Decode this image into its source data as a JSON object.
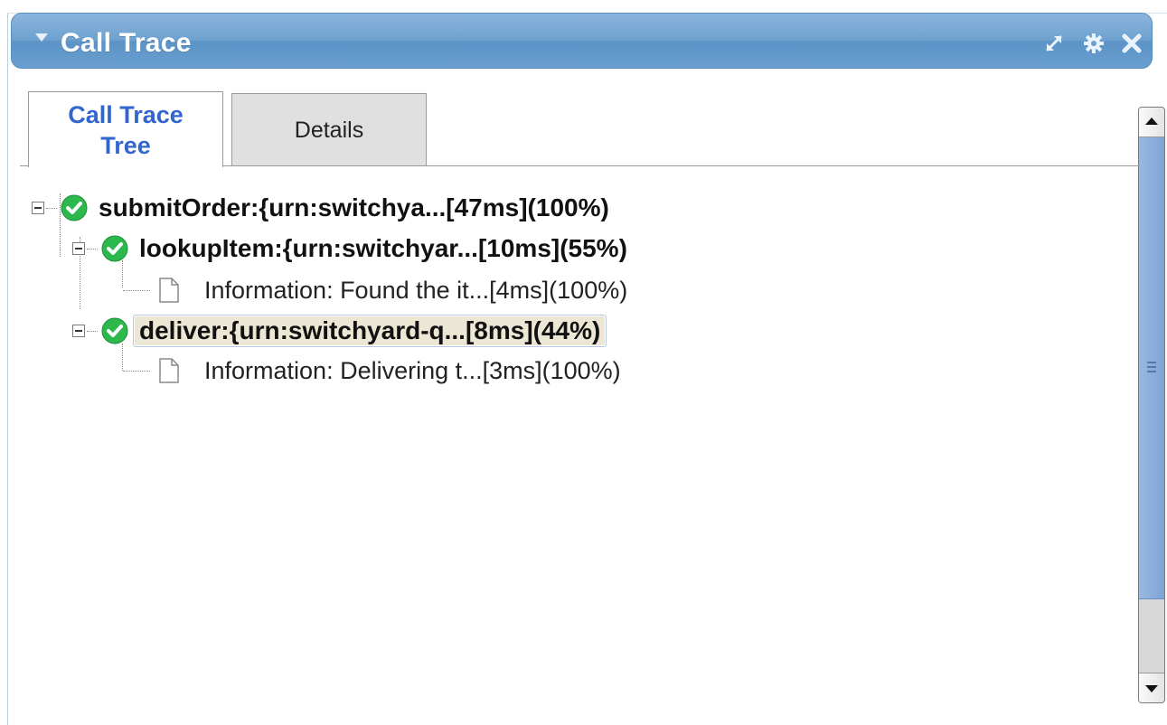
{
  "portlet": {
    "title": "Call Trace",
    "controls": [
      "maximize-icon",
      "gear-icon",
      "close-icon"
    ]
  },
  "tabs": [
    {
      "label": "Call Trace Tree",
      "active": true
    },
    {
      "label": "Details",
      "active": false
    }
  ],
  "tree": {
    "nodes": [
      {
        "level": 0,
        "type": "operation",
        "status": "success",
        "expanded": true,
        "label": "submitOrder:{urn:switchya...[47ms](100%)",
        "selected": false
      },
      {
        "level": 1,
        "type": "operation",
        "status": "success",
        "expanded": true,
        "label": "lookupItem:{urn:switchyar...[10ms](55%)",
        "selected": false
      },
      {
        "level": 2,
        "type": "information",
        "label": "Information: Found the it...[4ms](100%)"
      },
      {
        "level": 1,
        "type": "operation",
        "status": "success",
        "expanded": true,
        "label": "deliver:{urn:switchyard-q...[8ms](44%)",
        "selected": true
      },
      {
        "level": 2,
        "type": "information",
        "label": "Information: Delivering t...[3ms](100%)"
      }
    ]
  },
  "colors": {
    "titlebar": "#6fa2d0",
    "active_tab_text": "#3366cc",
    "success": "#2db84d",
    "selection": "#ece6d4",
    "scroll_thumb": "#8aaedc"
  }
}
